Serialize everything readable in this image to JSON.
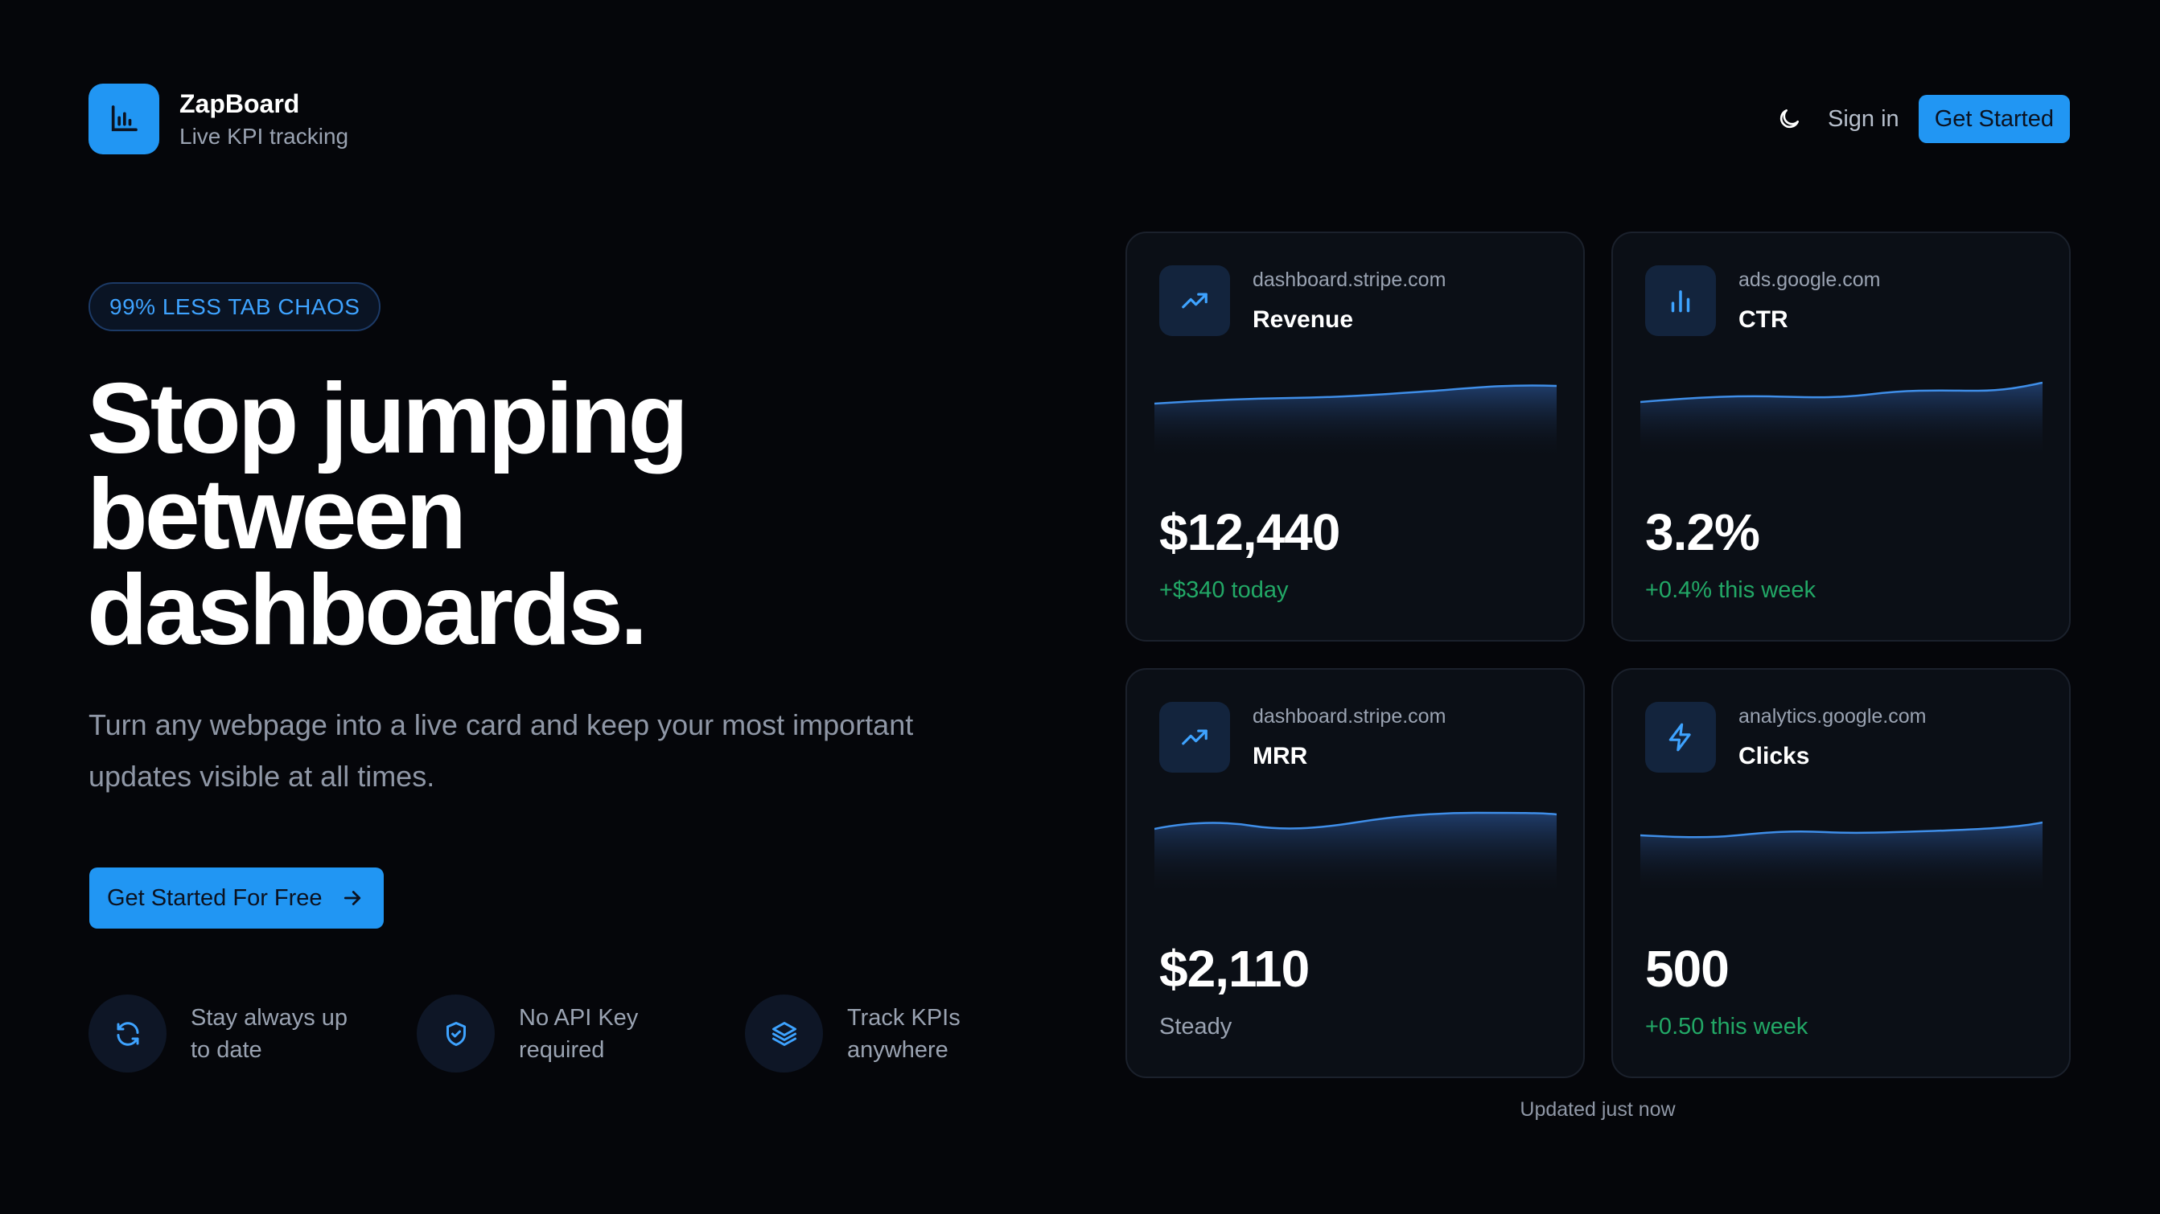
{
  "brand": {
    "name": "ZapBoard",
    "tagline": "Live KPI tracking",
    "icon": "bar-chart-icon",
    "accent": "#2196f3"
  },
  "nav": {
    "theme_icon": "moon-icon",
    "sign_in": "Sign in",
    "get_started": "Get Started"
  },
  "hero": {
    "badge": "99% LESS TAB CHAOS",
    "headline": [
      "Stop jumping",
      "between",
      "dashboards."
    ],
    "lead": "Turn any webpage into a live card and keep your most important updates visible at all times.",
    "cta_label": "Get Started For Free",
    "cta_icon": "arrow-right-icon"
  },
  "features": [
    {
      "icon": "refresh-icon",
      "text": "Stay always up to date"
    },
    {
      "icon": "shield-check-icon",
      "text": "No API Key required"
    },
    {
      "icon": "layers-icon",
      "text": "Track KPIs anywhere"
    }
  ],
  "cards": [
    {
      "source": "dashboard.stripe.com",
      "title": "Revenue",
      "value": "$12,440",
      "change": "+$340 today",
      "change_color": "#22a866",
      "icon": "trending-up-icon"
    },
    {
      "source": "ads.google.com",
      "title": "CTR",
      "value": "3.2%",
      "change": "+0.4% this week",
      "change_color": "#22a866",
      "icon": "bar-chart-icon"
    },
    {
      "source": "dashboard.stripe.com",
      "title": "MRR",
      "value": "$2,110",
      "change": "Steady",
      "change_color": "#9aa3b2",
      "icon": "trending-up-icon"
    },
    {
      "source": "analytics.google.com",
      "title": "Clicks",
      "value": "500",
      "change": "+0.50 this week",
      "change_color": "#22a866",
      "icon": "lightning-icon"
    }
  ],
  "footer": {
    "updated": "Updated just now"
  }
}
